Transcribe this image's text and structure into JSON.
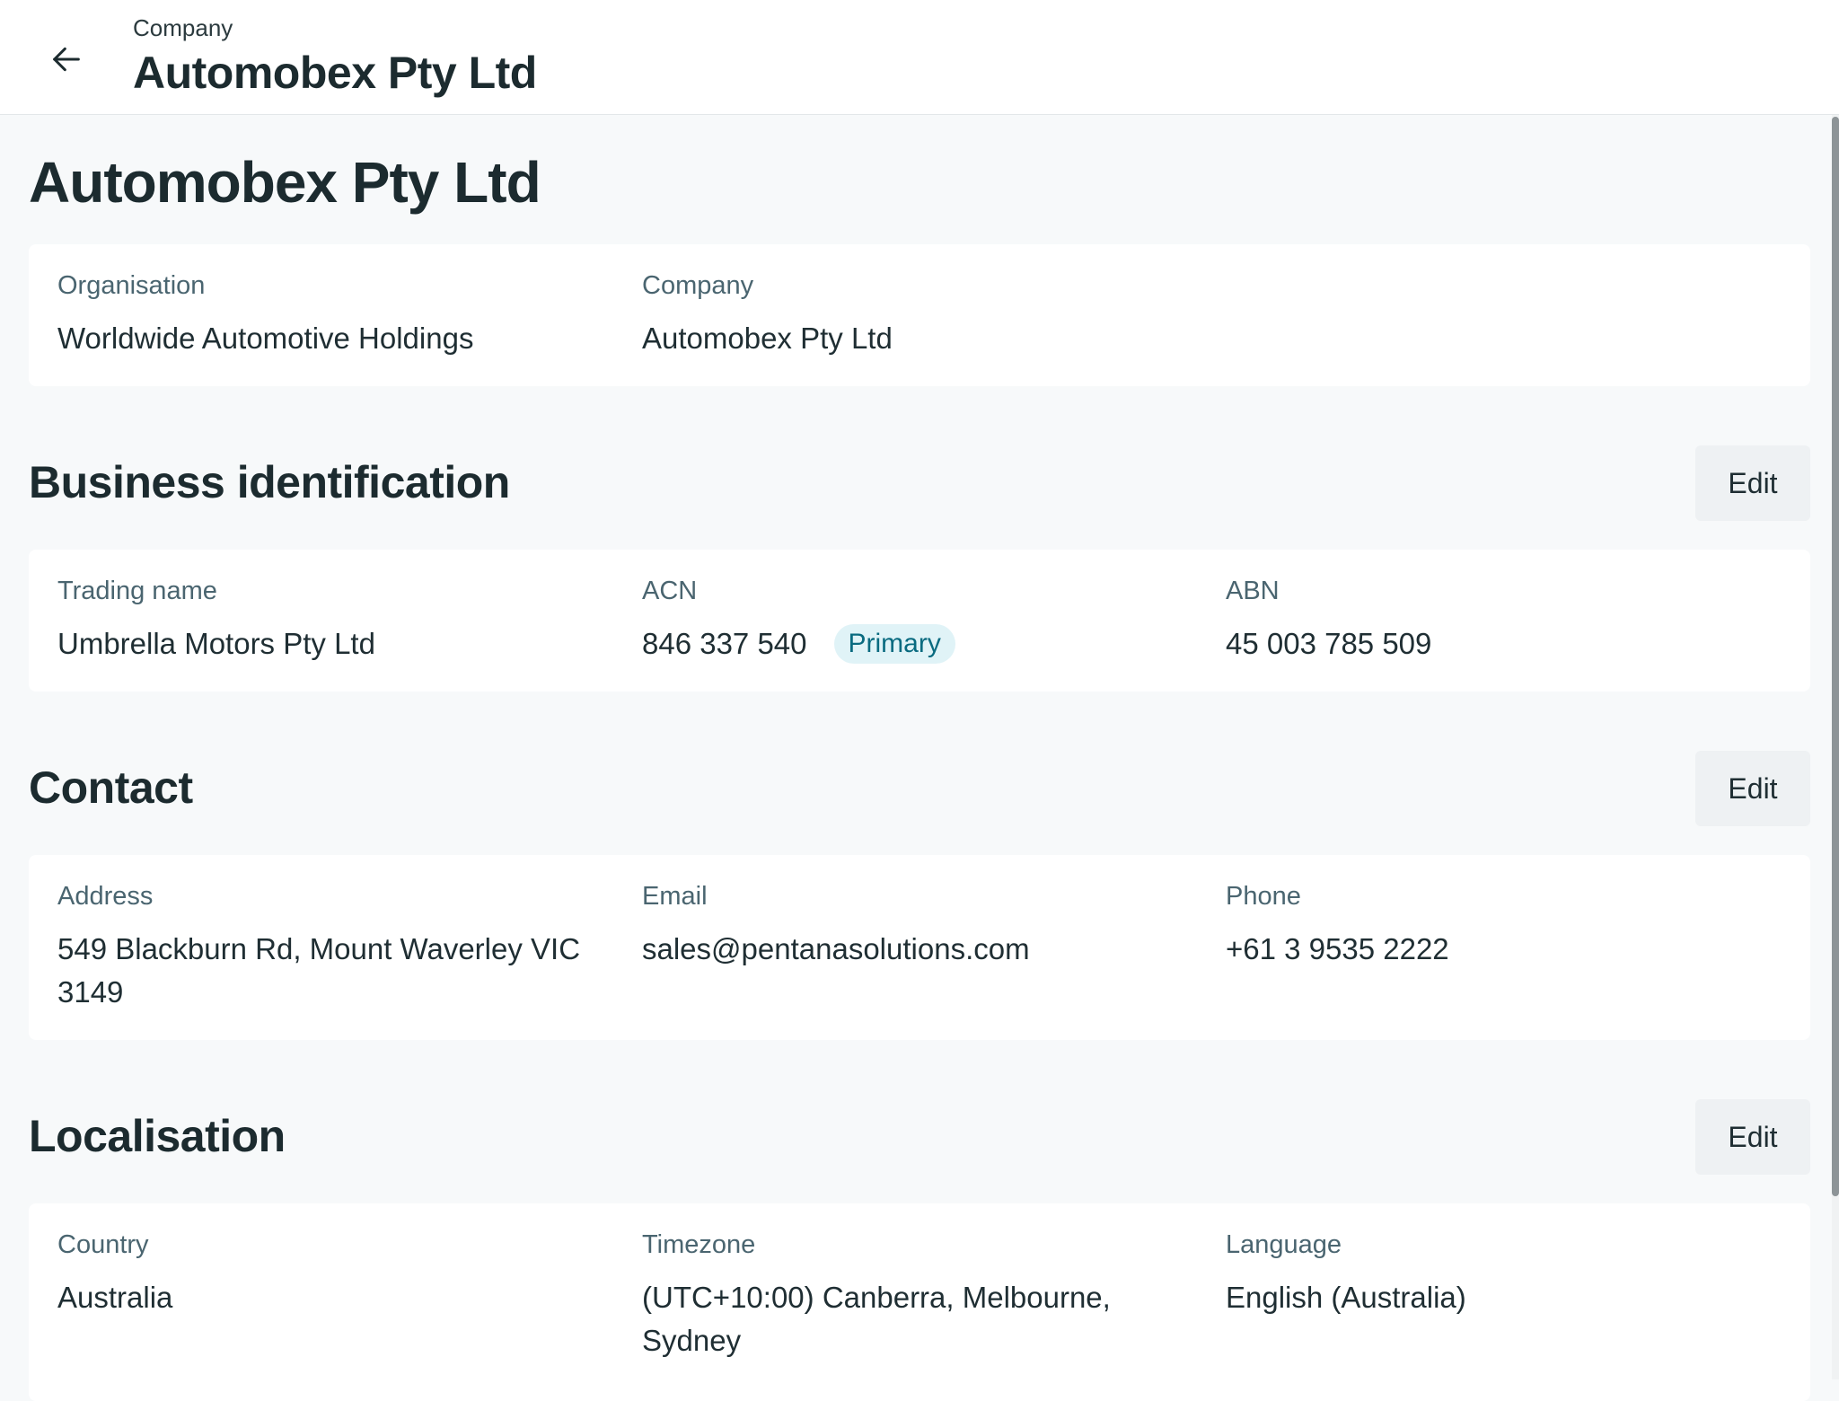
{
  "header": {
    "eyebrow": "Company",
    "title": "Automobex Pty Ltd",
    "back_icon": "arrow-left-icon"
  },
  "page": {
    "title": "Automobex Pty Ltd"
  },
  "summary": {
    "organisation_label": "Organisation",
    "organisation_value": "Worldwide Automotive Holdings",
    "company_label": "Company",
    "company_value": "Automobex Pty Ltd"
  },
  "business": {
    "title": "Business identification",
    "edit_label": "Edit",
    "trading_name_label": "Trading name",
    "trading_name_value": "Umbrella Motors Pty Ltd",
    "acn_label": "ACN",
    "acn_value": "846 337 540",
    "acn_badge": "Primary",
    "abn_label": "ABN",
    "abn_value": "45 003 785 509"
  },
  "contact": {
    "title": "Contact",
    "edit_label": "Edit",
    "address_label": "Address",
    "address_value": "549 Blackburn Rd, Mount Waverley VIC 3149",
    "email_label": "Email",
    "email_value": "sales@pentanasolutions.com",
    "phone_label": "Phone",
    "phone_value": "+61 3 9535 2222"
  },
  "localisation": {
    "title": "Localisation",
    "edit_label": "Edit",
    "country_label": "Country",
    "country_value": "Australia",
    "timezone_label": "Timezone",
    "timezone_value": "(UTC+10:00) Canberra, Melbourne, Sydney",
    "language_label": "Language",
    "language_value": "English (Australia)"
  },
  "colors": {
    "background": "#f7f9fa",
    "card": "#ffffff",
    "text": "#1c2b2f",
    "label": "#4a6570",
    "badge_bg": "#e0f3f7",
    "badge_text": "#0a6b80",
    "button_bg": "#eef1f3"
  }
}
